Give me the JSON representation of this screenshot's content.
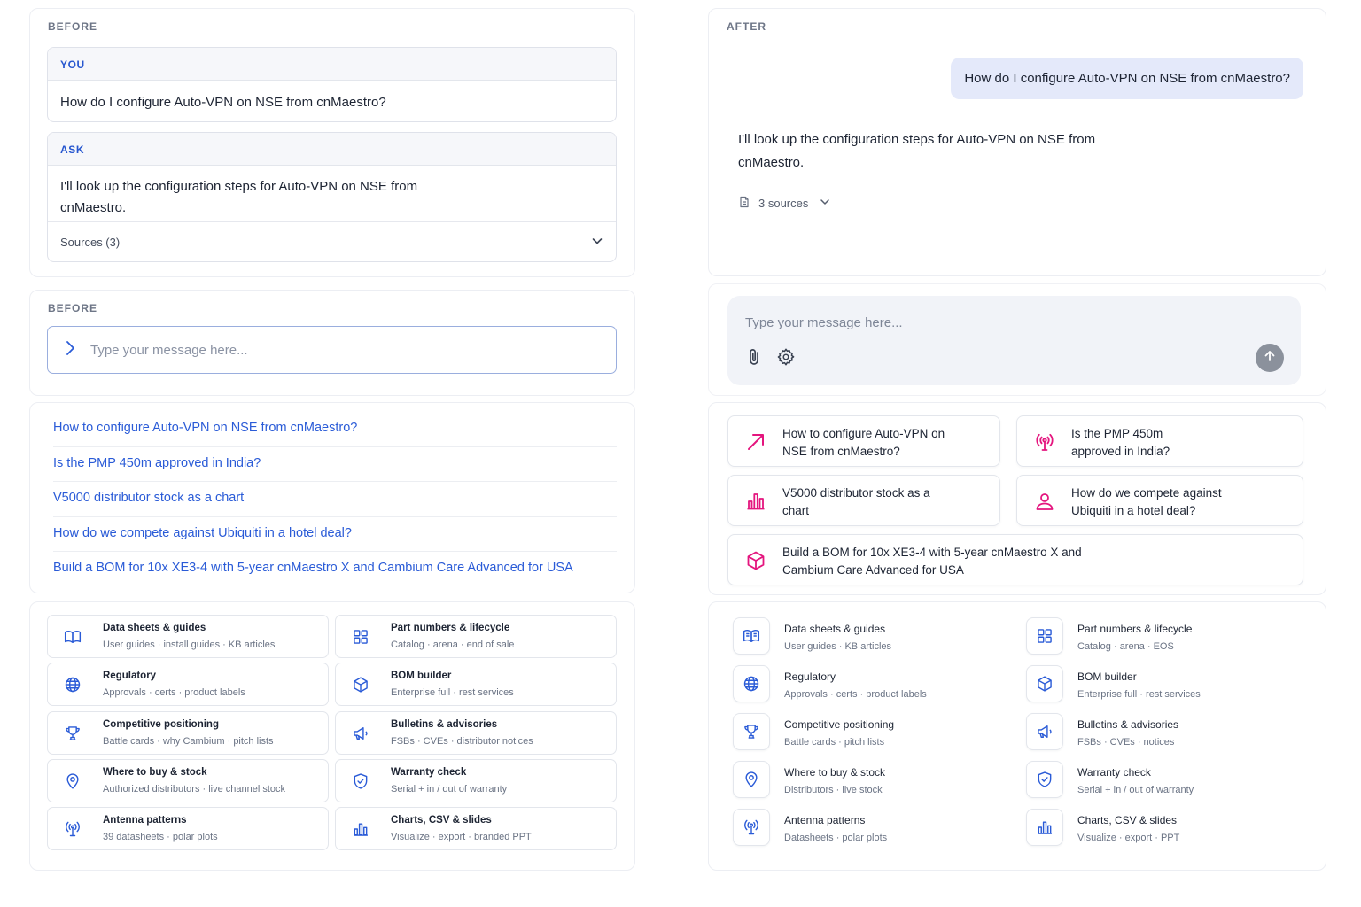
{
  "before_conversation": {
    "label": "BEFORE",
    "you_label": "YOU",
    "you_text": "How do I configure Auto-VPN on NSE from cnMaestro?",
    "ask_label": "ASK",
    "ask_text": "I'll look up the configuration steps for Auto-VPN on NSE from cnMaestro.",
    "sources_label": "Sources (3)"
  },
  "before_input": {
    "label": "BEFORE",
    "placeholder": "Type your message here..."
  },
  "before_suggestions": [
    "How to configure Auto-VPN on NSE from cnMaestro?",
    "Is the PMP 450m approved in India?",
    "V5000 distributor stock as a chart",
    "How do we compete against Ubiquiti in a hotel deal?",
    "Build a BOM for 10x XE3-4 with 5-year cnMaestro X and Cambium Care Advanced for USA"
  ],
  "before_categories": [
    {
      "icon": "book-icon",
      "title": "Data sheets & guides",
      "sub": "User guides · install guides · KB articles"
    },
    {
      "icon": "grid-icon",
      "title": "Part numbers & lifecycle",
      "sub": "Catalog · arena · end of sale"
    },
    {
      "icon": "globe-icon",
      "title": "Regulatory",
      "sub": "Approvals · certs · product labels"
    },
    {
      "icon": "cube-icon",
      "title": "BOM builder",
      "sub": "Enterprise full · rest services"
    },
    {
      "icon": "trophy-icon",
      "title": "Competitive positioning",
      "sub": "Battle cards · why Cambium · pitch lists"
    },
    {
      "icon": "megaphone-icon",
      "title": "Bulletins & advisories",
      "sub": "FSBs · CVEs · distributor notices"
    },
    {
      "icon": "location-pin-icon",
      "title": "Where to buy & stock",
      "sub": "Authorized distributors · live channel stock"
    },
    {
      "icon": "shield-check-icon",
      "title": "Warranty check",
      "sub": "Serial + in / out of warranty"
    },
    {
      "icon": "antenna-icon",
      "title": "Antenna patterns",
      "sub": "39 datasheets · polar plots"
    },
    {
      "icon": "bar-chart-icon",
      "title": "Charts, CSV & slides",
      "sub": "Visualize · export · branded PPT"
    }
  ],
  "after_conversation": {
    "label": "AFTER",
    "user_text": "How do I configure Auto-VPN on NSE from cnMaestro?",
    "assistant_text": "I'll look up the configuration steps for Auto-VPN on NSE from cnMaestro.",
    "sources_label": "3 sources"
  },
  "after_input": {
    "placeholder": "Type your message here..."
  },
  "after_suggestions": [
    {
      "icon": "arrow-up-right-icon",
      "text": "How to configure Auto-VPN on NSE from cnMaestro?"
    },
    {
      "icon": "antenna-icon",
      "text": "Is the PMP 450m approved in India?"
    },
    {
      "icon": "bar-chart-icon",
      "text": "V5000 distributor stock as a chart"
    },
    {
      "icon": "person-icon",
      "text": "How do we compete against Ubiquiti in a hotel deal?"
    },
    {
      "icon": "cube-icon",
      "text": "Build a BOM for 10x XE3-4 with 5-year cnMaestro X and Cambium Care Advanced for USA"
    }
  ],
  "after_categories": [
    {
      "icon": "book-icon",
      "title": "Data sheets & guides",
      "sub": "User guides · KB articles"
    },
    {
      "icon": "grid-icon",
      "title": "Part numbers & lifecycle",
      "sub": "Catalog · arena · EOS"
    },
    {
      "icon": "globe-icon",
      "title": "Regulatory",
      "sub": "Approvals · certs · product labels"
    },
    {
      "icon": "cube-icon",
      "title": "BOM builder",
      "sub": "Enterprise full · rest services"
    },
    {
      "icon": "trophy-icon",
      "title": "Competitive positioning",
      "sub": "Battle cards · pitch lists"
    },
    {
      "icon": "megaphone-icon",
      "title": "Bulletins & advisories",
      "sub": "FSBs · CVEs · notices"
    },
    {
      "icon": "location-pin-icon",
      "title": "Where to buy & stock",
      "sub": "Distributors · live stock"
    },
    {
      "icon": "shield-check-icon",
      "title": "Warranty check",
      "sub": "Serial + in / out of warranty"
    },
    {
      "icon": "antenna-icon",
      "title": "Antenna patterns",
      "sub": "Datasheets · polar plots"
    },
    {
      "icon": "bar-chart-icon",
      "title": "Charts, CSV & slides",
      "sub": "Visualize · export · PPT"
    }
  ],
  "colors": {
    "accent_blue": "#2a5bd7",
    "accent_pink": "#e4157e",
    "bubble": "#e4e9fa"
  }
}
